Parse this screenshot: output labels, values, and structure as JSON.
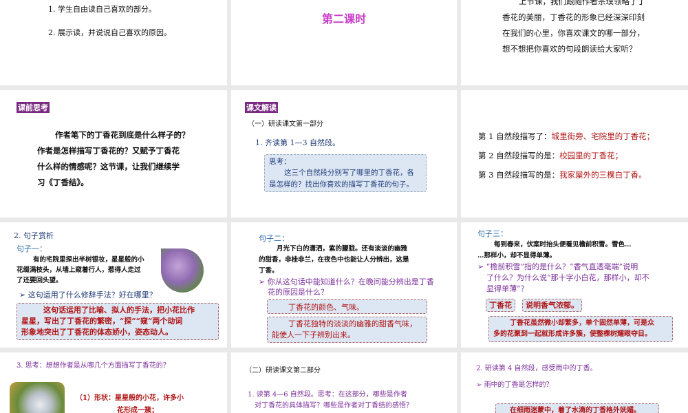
{
  "slides": [
    {
      "lines": [
        "1. 学生自由读自己喜欢的部分。",
        "2. 展示读，并说说自己喜欢的原因。"
      ]
    },
    {
      "title": "第二课时"
    },
    {
      "lines": [
        "上节课，我们跟随作者宗璞领略了丁",
        "香花的美丽，丁香花的形象已经深深印刻",
        "在我们的心里，你喜欢课文的哪一部分，",
        "想不想把你喜欢的句段朗读给大家听？"
      ]
    },
    {
      "tag": "课前思考",
      "lines": [
        "作者笔下的丁香花到底是什么样子的？",
        "作者是怎样描写丁香花的？又赋予丁香花",
        "什么样的情感呢？这节课，让我们继续学",
        "习《丁香结》。"
      ]
    },
    {
      "tag": "课文解读",
      "sub": "（一）研读课文第一部分",
      "item": "1. 齐读第 1—3 自然段。",
      "box_title": "思考：",
      "box_lines": [
        "这三个自然段分别写了哪里的丁香花，各",
        "是怎样的？找出你喜欢的描写丁香花的句子。"
      ]
    },
    {
      "rows": [
        {
          "label": "第 1 自然段描写了：",
          "answer": "城里街旁、宅院里的丁香花；"
        },
        {
          "label": "第 2 自然段描写的是：",
          "answer": "校园里的丁香花；"
        },
        {
          "label": "第 3 自然段描写的是：",
          "answer": "我家屋外的三棵白丁香。"
        }
      ]
    },
    {
      "heading": "2. 句子赏析",
      "label": "句子一：",
      "lines": [
        "有的宅院里探出半树银妆，星星般的小",
        "花缀满枝头，从墙上窥着行人，惹得人走过",
        "了还要回头望。"
      ],
      "question": "这句运用了什么修辞手法？好在哪里？",
      "answer": [
        "这句话运用了比喻、拟人的手法，把小花比作",
        "星星，写出了丁香花的繁密，“探”“窥”两个动词",
        "形象地突出了丁香花的体态娇小，姿态动人。"
      ]
    },
    {
      "label": "句子二：",
      "lines": [
        "月光下白的潇洒，紫的朦胧。还有淡淡的幽雅",
        "的甜香，非桂非兰，在夜色中也能让人分辨出，这是",
        "丁香。"
      ],
      "question": [
        "你从这句话中能知道什么？在晚间能分辨出是丁香",
        "花的原因是什么？"
      ],
      "answer1": "丁香花的颜色、气味。",
      "answer2": [
        "丁香花独特的淡淡的幽雅的甜香气味，",
        "能使人一下子辨别出来。"
      ]
    },
    {
      "label": "句子三：",
      "lines": [
        "每到春来，伏案时抬头便看见檐前积雪。雪色…",
        "…那样小，却不显得单薄。"
      ],
      "question": [
        "“檐前积雪”指的是什么？“香气直透毫端”说明",
        "了什么？为什么说“那十字小白花，那样小，却不",
        "显得单薄”？"
      ],
      "chip1": "丁香花",
      "chip2": "说明香气浓郁。",
      "answer": [
        "丁香花虽然微小却繁多，单个固然单薄，可是众",
        "多的花聚到一起就形成许多簇，使整棵树耀眼夺目。"
      ]
    },
    {
      "heading": "3. 思考：想想作者是从哪几个方面描写丁香花的？",
      "lines": [
        "（1）形状：星星般的小花，许多小",
        "花形成一簇；"
      ]
    },
    {
      "sub": "（二）研读课文第二部分",
      "lines": [
        "1. 读第 4—6 自然段。思考：在这部分，哪些是作者",
        "对丁香花的具体描写？哪些是作者对丁香结的感悟？"
      ]
    },
    {
      "heading": "2. 研读第 4 自然段，感受雨中的丁香。",
      "question": "雨中的丁香是怎样的？",
      "answer": "在细雨迷蒙中，着了水滴的丁香格外妩媚。"
    }
  ],
  "colors": {
    "purple": "#7b2f9a",
    "red": "#b01515",
    "tag": "#7a2a82",
    "box": "#dde7f4"
  }
}
